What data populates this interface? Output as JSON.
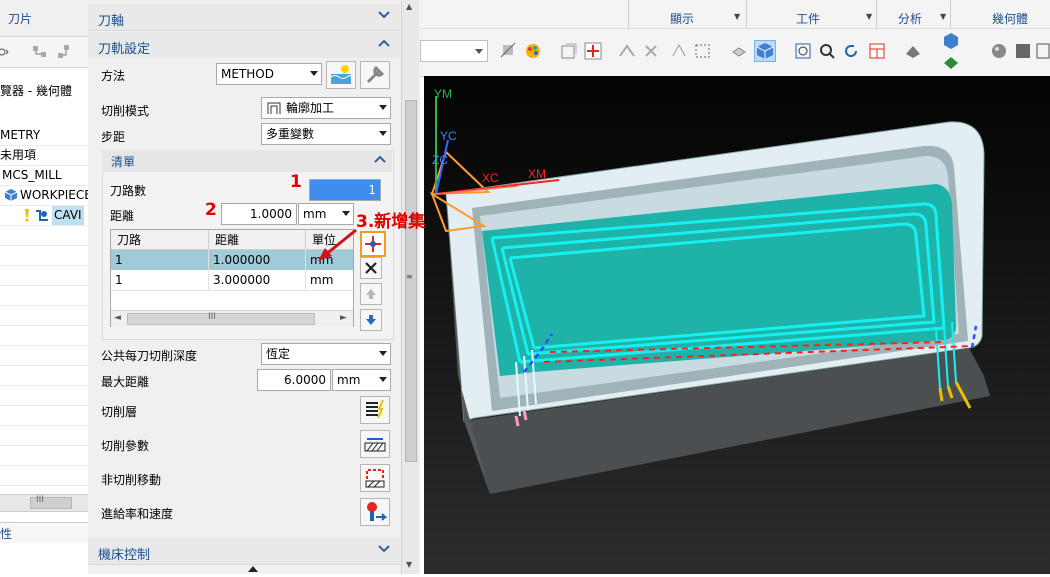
{
  "navigator": {
    "top_tab": "刀片",
    "header": "覽器 - 幾何體",
    "rows": [
      "METRY",
      "未用項",
      "MCS_MILL",
      "WORKPIECE",
      "CAVI"
    ],
    "bottom_label": "性"
  },
  "dialog": {
    "sections": {
      "tool_axis": "刀軸",
      "path_settings": "刀軌設定",
      "list": "清單",
      "machine_control": "機床控制"
    },
    "method": {
      "label": "方法",
      "value": "METHOD"
    },
    "cut_pattern": {
      "label": "切削模式",
      "value": "輪廓加工"
    },
    "stepover": {
      "label": "步距",
      "value": "多重變數"
    },
    "path_count": {
      "label": "刀路數",
      "value": "1"
    },
    "distance": {
      "label": "距離",
      "value": "1.0000",
      "unit": "mm"
    },
    "table": {
      "headers": [
        "刀路",
        "距離",
        "單位"
      ],
      "rows": [
        {
          "path": "1",
          "distance": "1.000000",
          "unit": "mm"
        },
        {
          "path": "1",
          "distance": "3.000000",
          "unit": "mm"
        }
      ],
      "scroll_thumb": "III"
    },
    "common_depth": {
      "label": "公共每刀切削深度",
      "value": "恆定"
    },
    "max_distance": {
      "label": "最大距離",
      "value": "6.0000",
      "unit": "mm"
    },
    "actions": [
      {
        "label": "切削層",
        "icon": "cut-levels-icon"
      },
      {
        "label": "切削參數",
        "icon": "cut-parameters-icon"
      },
      {
        "label": "非切削移動",
        "icon": "non-cutting-moves-icon"
      },
      {
        "label": "進給率和速度",
        "icon": "feeds-speeds-icon"
      }
    ]
  },
  "annotations": {
    "step1": "1",
    "step2": "2",
    "step3": "3.新增集"
  },
  "ribbon": {
    "groups": [
      "顯示",
      "工件",
      "分析",
      "幾何體"
    ]
  },
  "viewport": {
    "axis_labels": {
      "ym": "YM",
      "yc": "YC",
      "zc": "ZC",
      "xc": "XC",
      "xm": "XM"
    },
    "colors": {
      "background": "#141414",
      "floor": "#1fb2a8",
      "wall": "#e2eef2",
      "toolpath": "#17f0f0",
      "engage": "#ff2020"
    }
  }
}
